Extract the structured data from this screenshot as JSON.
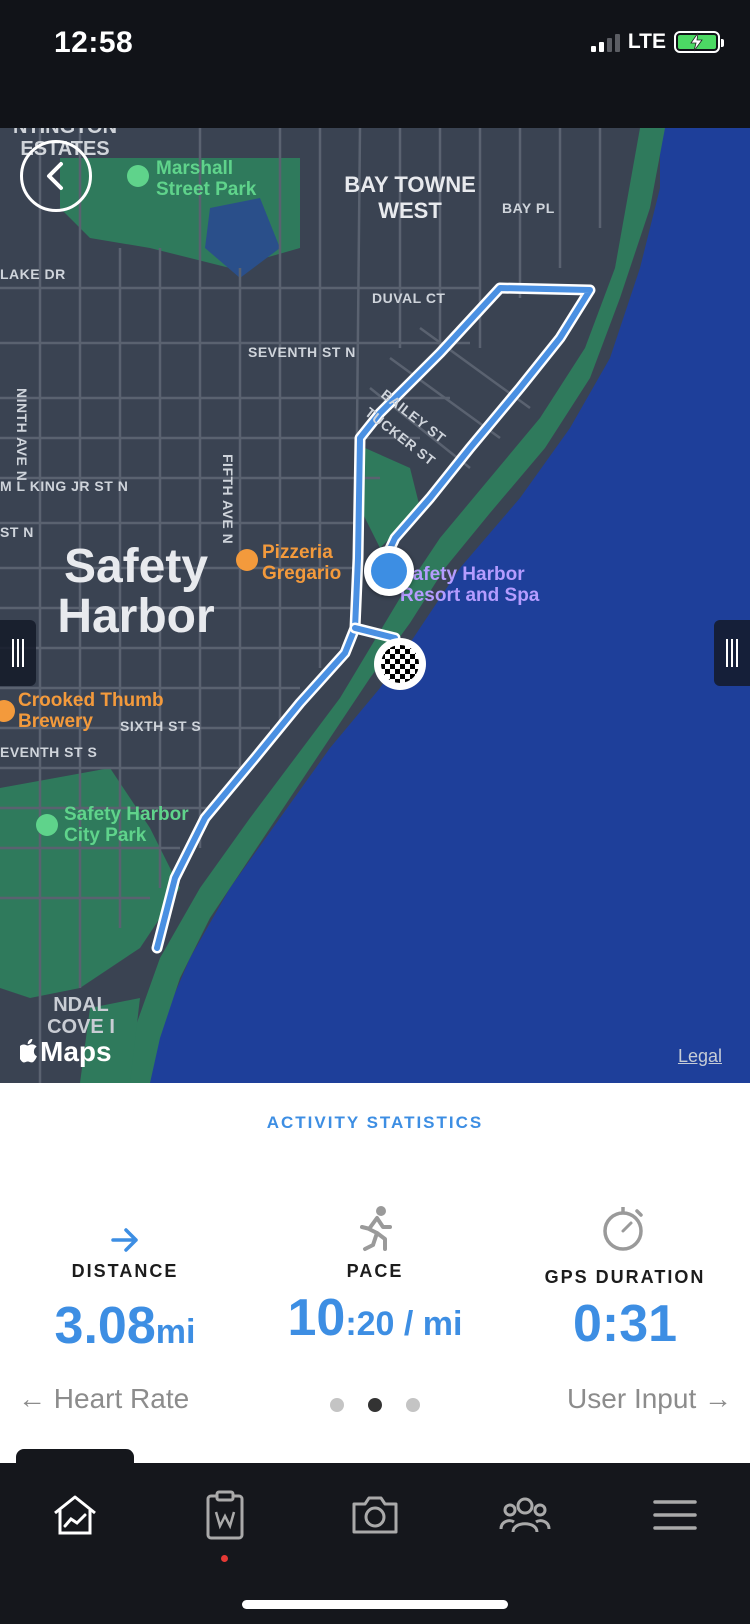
{
  "status_bar": {
    "time": "12:58",
    "network": "LTE"
  },
  "map": {
    "labels": {
      "top_estates": "NTINGTON ESTATES",
      "marshall_park": "Marshall Street Park",
      "bay_towne_west": "BAY TOWNE WEST",
      "bay_pl": "BAY PL",
      "lake_dr": "LAKE DR",
      "duval_ct": "DUVAL CT",
      "seventh_st_n": "SEVENTH ST N",
      "ninth_ave_n": "NINTH AVE N",
      "bailey_st": "BAILEY ST",
      "tucker_st": "TUCKER ST",
      "ml_king": "M L KING JR ST N",
      "fifth_ave_n": "FIFTH AVE N",
      "st_n": "ST N",
      "city": "Safety Harbor",
      "pizzeria": "Pizzeria Gregario",
      "resort": "Safety Harbor Resort and Spa",
      "crooked_thumb": "Crooked Thumb Brewery",
      "sixth_st_s": "SIXTH ST S",
      "seventh_st_s": "EVENTH ST S",
      "city_park": "Safety Harbor City Park",
      "bottom_cove": "NDAL COVE I"
    },
    "attribution": "Maps",
    "legal": "Legal"
  },
  "stats": {
    "title": "ACTIVITY STATISTICS",
    "distance": {
      "label": "DISTANCE",
      "value": "3.08",
      "unit": "mi"
    },
    "pace": {
      "label": "PACE",
      "value": "10",
      "unit": ":20 / mi"
    },
    "gps_duration": {
      "label": "GPS DURATION",
      "value": "0:31"
    },
    "prev_label": "Heart Rate",
    "next_label": "User Input",
    "page_index": 2,
    "page_count": 3
  },
  "colors": {
    "accent": "#3d8ee3",
    "route": "#4a90e2",
    "water": "#1e3f9a",
    "land": "#3a4352",
    "park": "#2f7a5c"
  },
  "tabs": [
    "home-icon",
    "workout-log-icon",
    "camera-icon",
    "community-icon",
    "menu-icon"
  ]
}
